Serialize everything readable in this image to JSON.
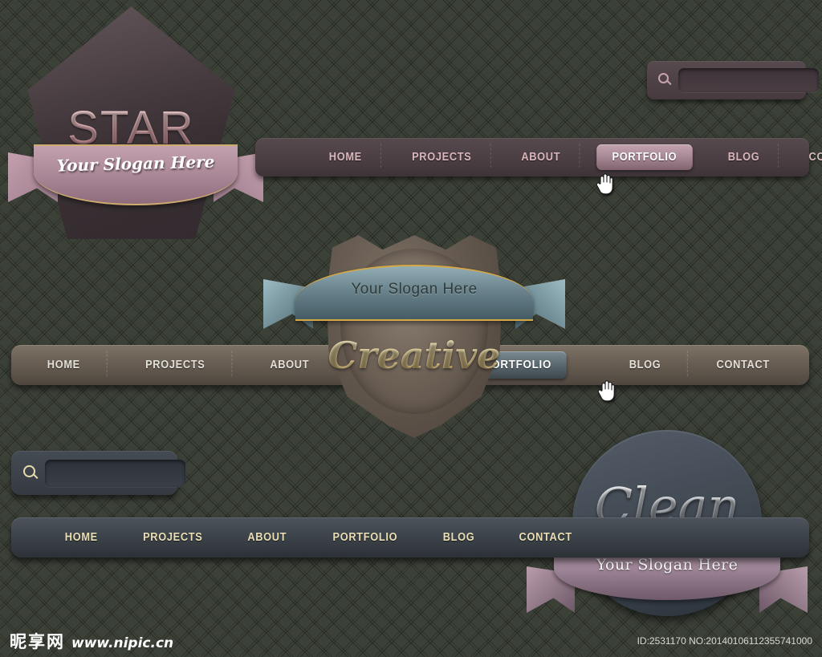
{
  "background": {
    "color": "#3c4138",
    "pattern": "diagonal-plaid-crosshatch"
  },
  "sets": {
    "star": {
      "logo_text": "STAR",
      "slogan": "Your Slogan Here",
      "accent_color": "#c5a3ae",
      "nav": [
        {
          "label": "HOME",
          "active": false
        },
        {
          "label": "PROJECTS",
          "active": false
        },
        {
          "label": "ABOUT",
          "active": false
        },
        {
          "label": "PORTFOLIO",
          "active": true
        },
        {
          "label": "BLOG",
          "active": false
        },
        {
          "label": "CONTACT",
          "active": false
        }
      ],
      "search": {
        "icon": "search-icon",
        "value": "",
        "placeholder": ""
      }
    },
    "creative": {
      "logo_text": "Creative",
      "slogan": "Your Slogan Here",
      "accent_color": "#5d6b72",
      "gold_color": "#d6a845",
      "nav": [
        {
          "label": "HOME",
          "active": false
        },
        {
          "label": "PROJECTS",
          "active": false
        },
        {
          "label": "ABOUT",
          "active": false
        },
        {
          "label": "PORTFOLIO",
          "active": true
        },
        {
          "label": "BLOG",
          "active": false
        },
        {
          "label": "CONTACT",
          "active": false
        }
      ]
    },
    "clean": {
      "logo_text": "Clean",
      "slogan": "Your Slogan Here",
      "accent_color": "#9c8395",
      "nav": [
        {
          "label": "HOME",
          "active": false
        },
        {
          "label": "PROJECTS",
          "active": false
        },
        {
          "label": "ABOUT",
          "active": false
        },
        {
          "label": "PORTFOLIO",
          "active": false
        },
        {
          "label": "BLOG",
          "active": false
        },
        {
          "label": "CONTACT",
          "active": false
        }
      ],
      "search": {
        "icon": "search-icon",
        "value": "",
        "placeholder": ""
      }
    }
  },
  "footer": {
    "watermark_cn": "昵享网",
    "watermark_url": "www.nipic.cn",
    "id_text": "ID:2531170 NO:20140106112355741000"
  }
}
